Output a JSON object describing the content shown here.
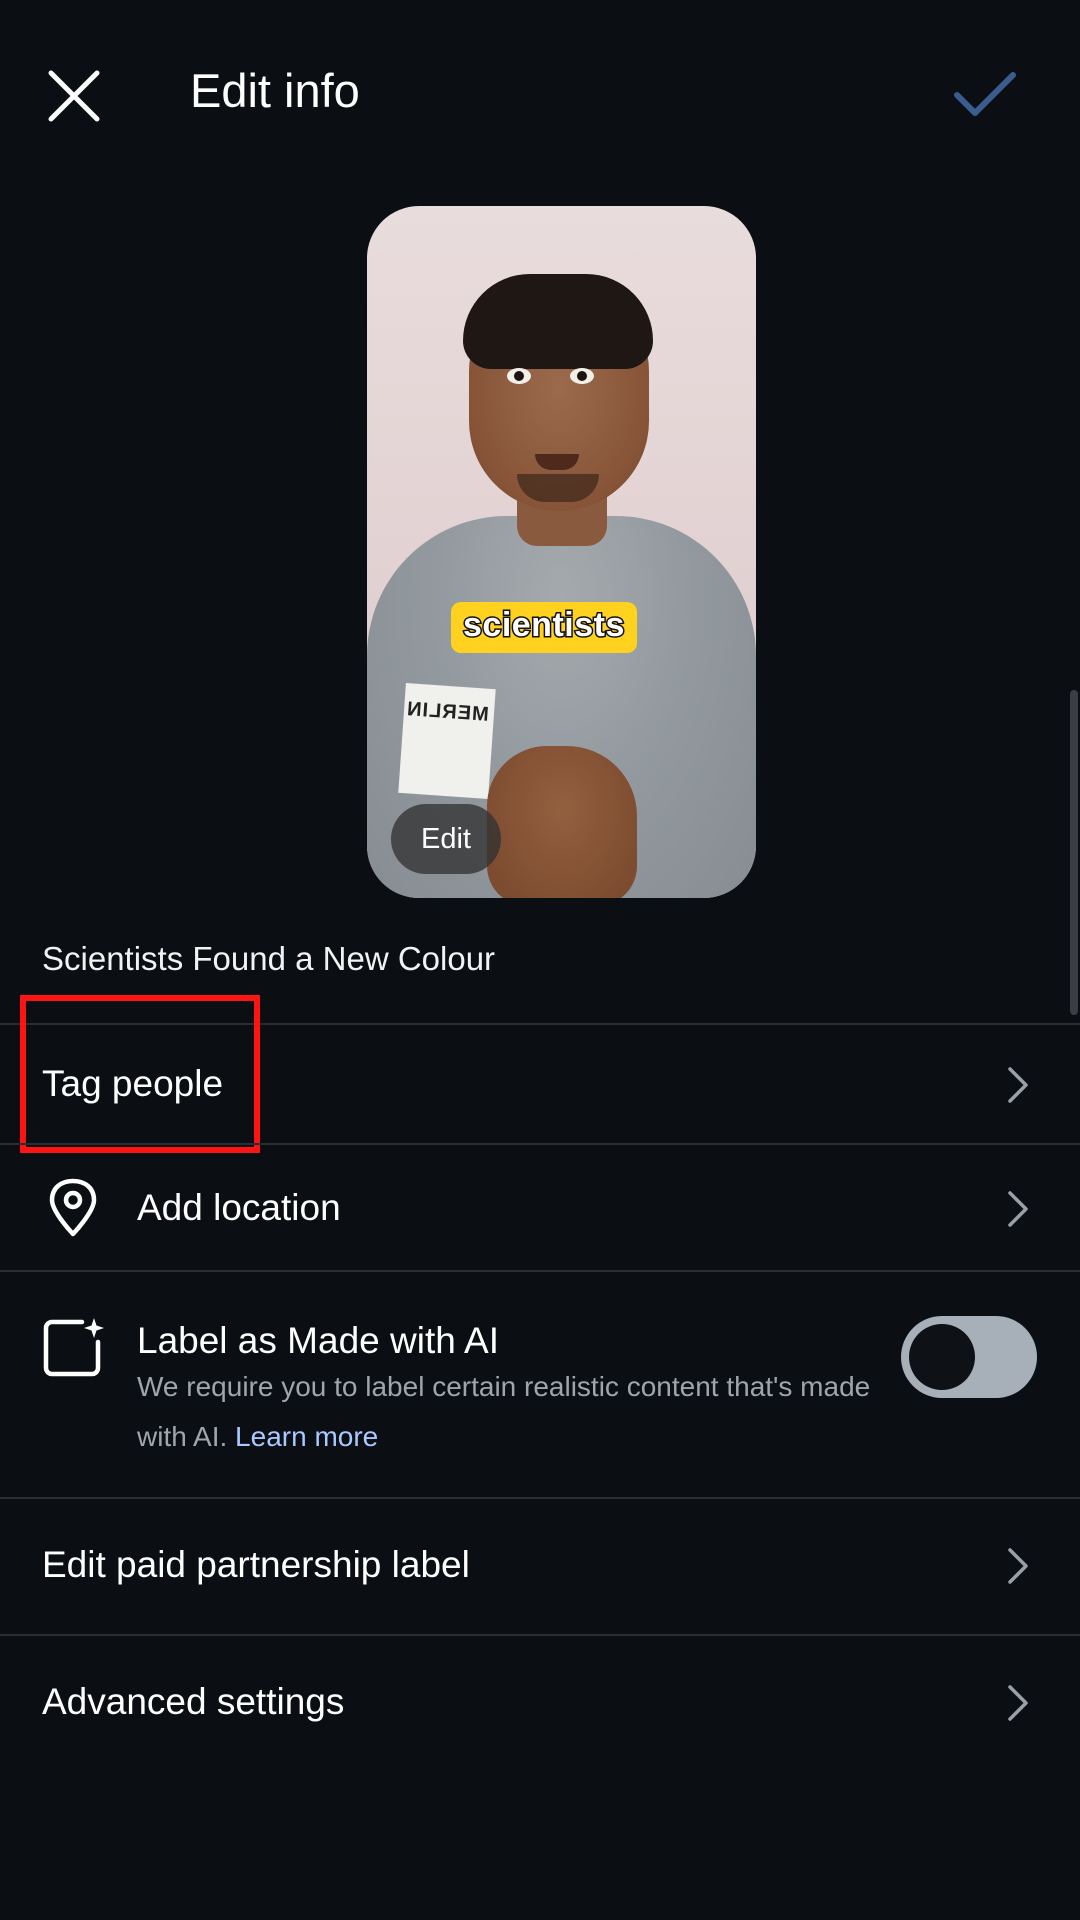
{
  "header": {
    "title": "Edit info",
    "close_icon": "close-icon",
    "confirm_icon": "checkmark-icon"
  },
  "thumbnail": {
    "caption": "scientists",
    "shirt_tag_text": "MERLIN",
    "edit_label": "Edit"
  },
  "video_title": "Scientists Found a New Colour",
  "rows": {
    "tag_people": {
      "label": "Tag people"
    },
    "add_location": {
      "label": "Add location",
      "icon": "location-pin-icon"
    },
    "ai_label": {
      "label": "Label as Made with AI",
      "icon": "ai-sparkle-icon",
      "description": "We require you to label certain realistic content that's made with AI.",
      "learn_more": "Learn more",
      "toggle_on": false
    },
    "paid_partnership": {
      "label": "Edit paid partnership label"
    },
    "advanced_settings": {
      "label": "Advanced settings"
    }
  },
  "colors": {
    "background": "#0b0f14",
    "confirm_check": "#3a5c8f",
    "highlight": "#ff1414",
    "link": "#a9c8ff"
  }
}
